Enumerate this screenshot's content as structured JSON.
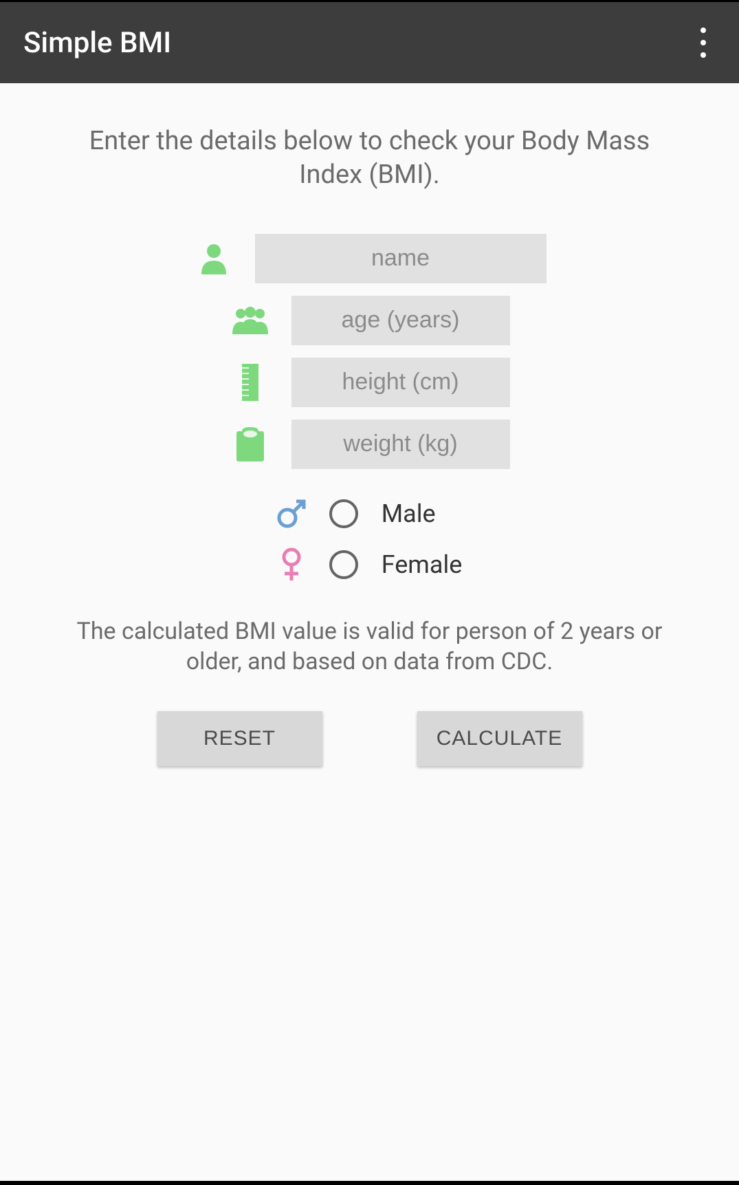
{
  "header": {
    "title": "Simple BMI"
  },
  "instruction": "Enter the details below to check your Body Mass Index (BMI).",
  "inputs": {
    "name": {
      "placeholder": "name",
      "value": ""
    },
    "age": {
      "placeholder": "age (years)",
      "value": ""
    },
    "height": {
      "placeholder": "height (cm)",
      "value": ""
    },
    "weight": {
      "placeholder": "weight (kg)",
      "value": ""
    }
  },
  "gender": {
    "male_label": "Male",
    "female_label": "Female"
  },
  "note": "The calculated BMI value is valid for person of 2 years or older, and based on data from CDC.",
  "buttons": {
    "reset": "RESET",
    "calculate": "CALCULATE"
  },
  "colors": {
    "icon_green": "#7ed97e",
    "male_blue": "#6a9fd4",
    "female_pink": "#e97eb4"
  }
}
